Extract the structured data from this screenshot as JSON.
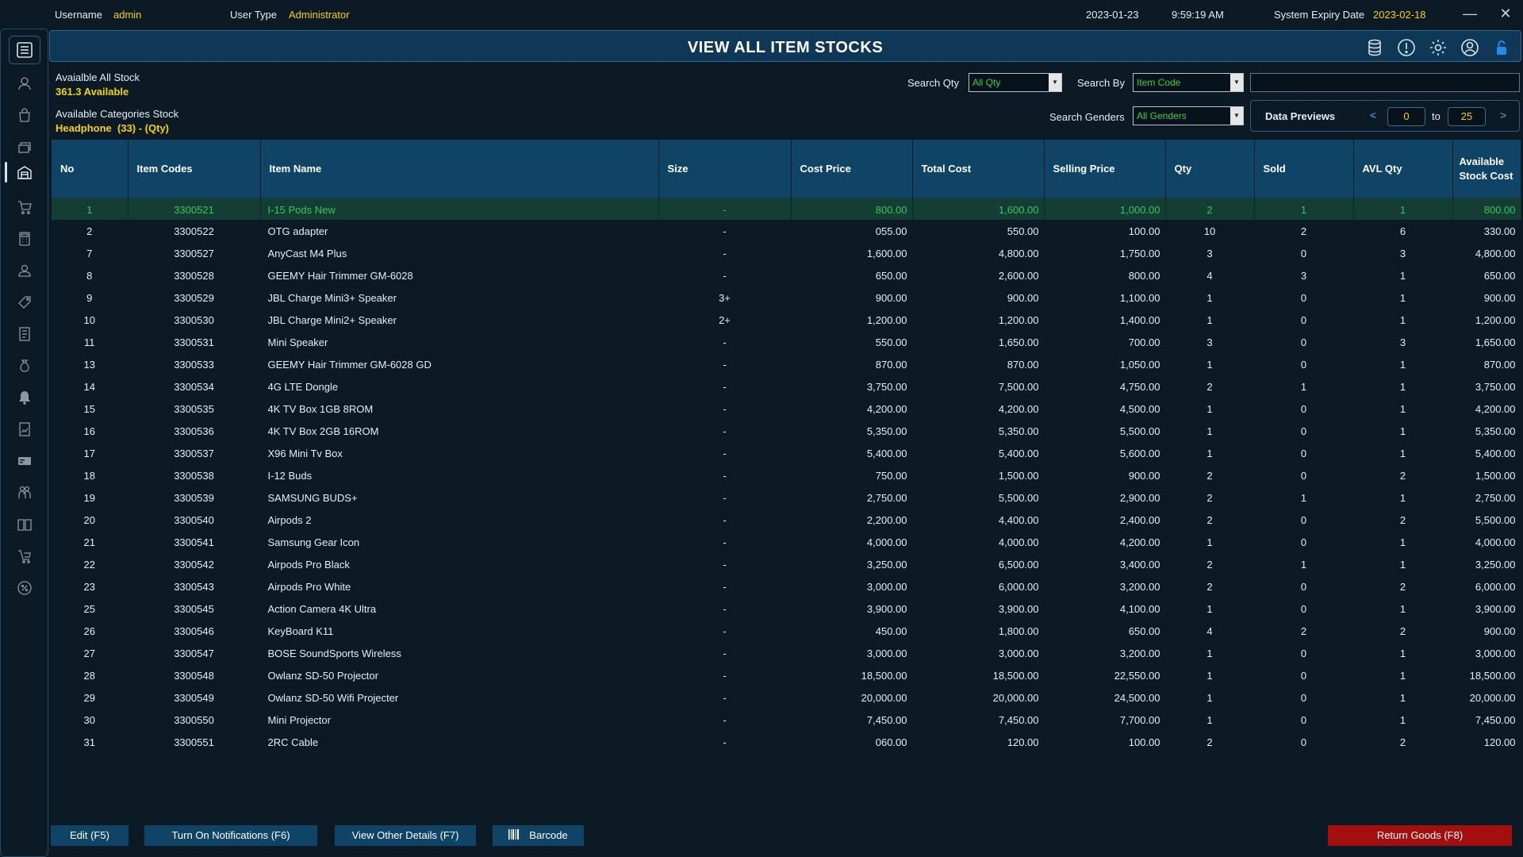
{
  "topbar": {
    "username_label": "Username",
    "username": "admin",
    "usertype_label": "User Type",
    "usertype": "Administrator",
    "date": "2023-01-23",
    "time": "9:59:19 AM",
    "expiry_label": "System Expiry Date",
    "expiry": "2023-02-18",
    "minimize": "—",
    "close": "✕"
  },
  "title": "VIEW ALL ITEM STOCKS",
  "summary": {
    "all_label": "Avaialble All Stock",
    "all_value": "361.3 Available",
    "cat_label": "Available Categories Stock",
    "cat_value": "Headphone  (33) - (Qty)"
  },
  "filters": {
    "search_qty_label": "Search Qty",
    "search_qty_value": "All Qty",
    "search_by_label": "Search By",
    "search_by_value": "Item Code",
    "search_text": "",
    "search_genders_label": "Search Genders",
    "search_genders_value": "All Genders",
    "data_previews_label": "Data Previews",
    "prev": "<",
    "next": ">",
    "from": "0",
    "to_label": "to",
    "to": "25"
  },
  "table": {
    "headers": [
      "No",
      "Item Codes",
      "Item Name",
      "Size",
      "Cost Price",
      "Total Cost",
      "Selling Price",
      "Qty",
      "Sold",
      "AVL Qty",
      "Available Stock Cost"
    ],
    "rows": [
      [
        "1",
        "3300521",
        "I-15 Pods New",
        "-",
        "800.00",
        "1,600.00",
        "1,000.00",
        "2",
        "1",
        "1",
        "800.00"
      ],
      [
        "2",
        "3300522",
        "OTG adapter",
        "-",
        "055.00",
        "550.00",
        "100.00",
        "10",
        "2",
        "6",
        "330.00"
      ],
      [
        "7",
        "3300527",
        "AnyCast M4 Plus",
        "-",
        "1,600.00",
        "4,800.00",
        "1,750.00",
        "3",
        "0",
        "3",
        "4,800.00"
      ],
      [
        "8",
        "3300528",
        "GEEMY Hair Trimmer GM-6028",
        "-",
        "650.00",
        "2,600.00",
        "800.00",
        "4",
        "3",
        "1",
        "650.00"
      ],
      [
        "9",
        "3300529",
        "JBL Charge Mini3+ Speaker",
        "3+",
        "900.00",
        "900.00",
        "1,100.00",
        "1",
        "0",
        "1",
        "900.00"
      ],
      [
        "10",
        "3300530",
        "JBL Charge Mini2+ Speaker",
        "2+",
        "1,200.00",
        "1,200.00",
        "1,400.00",
        "1",
        "0",
        "1",
        "1,200.00"
      ],
      [
        "11",
        "3300531",
        "Mini Speaker",
        "-",
        "550.00",
        "1,650.00",
        "700.00",
        "3",
        "0",
        "3",
        "1,650.00"
      ],
      [
        "13",
        "3300533",
        "GEEMY Hair Trimmer GM-6028 GD",
        "-",
        "870.00",
        "870.00",
        "1,050.00",
        "1",
        "0",
        "1",
        "870.00"
      ],
      [
        "14",
        "3300534",
        "4G LTE Dongle",
        "-",
        "3,750.00",
        "7,500.00",
        "4,750.00",
        "2",
        "1",
        "1",
        "3,750.00"
      ],
      [
        "15",
        "3300535",
        "4K TV Box 1GB 8ROM",
        "-",
        "4,200.00",
        "4,200.00",
        "4,500.00",
        "1",
        "0",
        "1",
        "4,200.00"
      ],
      [
        "16",
        "3300536",
        "4K TV Box 2GB 16ROM",
        "-",
        "5,350.00",
        "5,350.00",
        "5,500.00",
        "1",
        "0",
        "1",
        "5,350.00"
      ],
      [
        "17",
        "3300537",
        "X96 Mini Tv Box",
        "-",
        "5,400.00",
        "5,400.00",
        "5,600.00",
        "1",
        "0",
        "1",
        "5,400.00"
      ],
      [
        "18",
        "3300538",
        "I-12 Buds",
        "-",
        "750.00",
        "1,500.00",
        "900.00",
        "2",
        "0",
        "2",
        "1,500.00"
      ],
      [
        "19",
        "3300539",
        "SAMSUNG BUDS+",
        "-",
        "2,750.00",
        "5,500.00",
        "2,900.00",
        "2",
        "1",
        "1",
        "2,750.00"
      ],
      [
        "20",
        "3300540",
        "Airpods 2",
        "-",
        "2,200.00",
        "4,400.00",
        "2,400.00",
        "2",
        "0",
        "2",
        "5,500.00"
      ],
      [
        "21",
        "3300541",
        "Samsung Gear Icon",
        "-",
        "4,000.00",
        "4,000.00",
        "4,200.00",
        "1",
        "0",
        "1",
        "4,000.00"
      ],
      [
        "22",
        "3300542",
        "Airpods Pro Black",
        "-",
        "3,250.00",
        "6,500.00",
        "3,400.00",
        "2",
        "1",
        "1",
        "3,250.00"
      ],
      [
        "23",
        "3300543",
        "Airpods Pro White",
        "-",
        "3,000.00",
        "6,000.00",
        "3,200.00",
        "2",
        "0",
        "2",
        "6,000.00"
      ],
      [
        "25",
        "3300545",
        "Action Camera 4K Ultra",
        "-",
        "3,900.00",
        "3,900.00",
        "4,100.00",
        "1",
        "0",
        "1",
        "3,900.00"
      ],
      [
        "26",
        "3300546",
        "KeyBoard K11",
        "-",
        "450.00",
        "1,800.00",
        "650.00",
        "4",
        "2",
        "2",
        "900.00"
      ],
      [
        "27",
        "3300547",
        "BOSE SoundSports Wireless",
        "-",
        "3,000.00",
        "3,000.00",
        "3,200.00",
        "1",
        "0",
        "1",
        "3,000.00"
      ],
      [
        "28",
        "3300548",
        "Owlanz SD-50 Projector",
        "-",
        "18,500.00",
        "18,500.00",
        "22,550.00",
        "1",
        "0",
        "1",
        "18,500.00"
      ],
      [
        "29",
        "3300549",
        "Owlanz SD-50 Wifi Projecter",
        "-",
        "20,000.00",
        "20,000.00",
        "24,500.00",
        "1",
        "0",
        "1",
        "20,000.00"
      ],
      [
        "30",
        "3300550",
        "Mini Projector",
        "-",
        "7,450.00",
        "7,450.00",
        "7,700.00",
        "1",
        "0",
        "1",
        "7,450.00"
      ],
      [
        "31",
        "3300551",
        "2RC Cable",
        "-",
        "060.00",
        "120.00",
        "100.00",
        "2",
        "0",
        "2",
        "120.00"
      ]
    ]
  },
  "buttons": {
    "edit": "Edit (F5)",
    "notifications": "Turn On Notifications (F6)",
    "details": "View Other Details (F7)",
    "barcode": "Barcode",
    "return": "Return Goods (F8)"
  },
  "colors": {
    "accent": "#0f4466",
    "highlight": "#f5d20a",
    "selected_row": "#143d33",
    "danger": "#a30f0f"
  }
}
